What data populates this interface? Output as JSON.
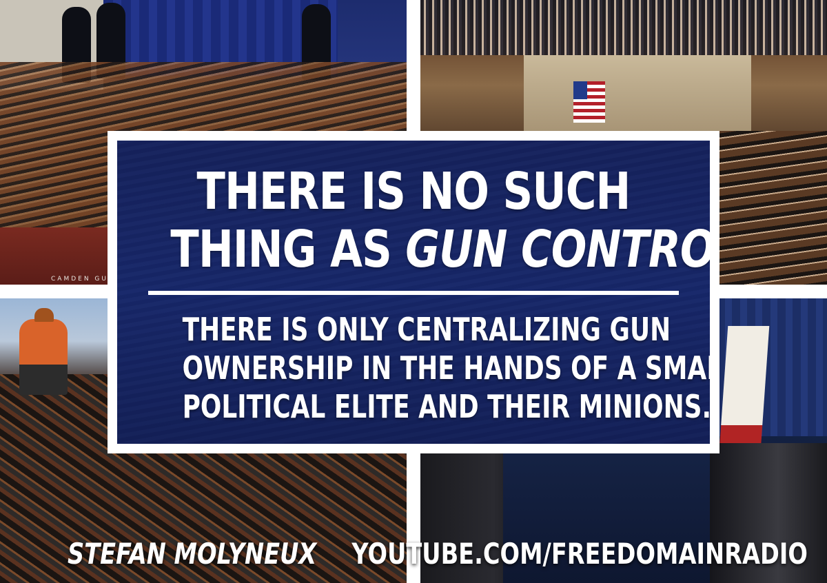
{
  "headline": {
    "line1": "THERE IS NO SUCH",
    "line2_prefix": "THING AS ",
    "line2_emphasis": "GUN CONTROL."
  },
  "subheadline": {
    "line1": "THERE IS ONLY CENTRALIZING GUN",
    "line2": "OWNERSHIP IN THE HANDS OF A SMALL",
    "line3": "POLITICAL ELITE AND THEIR MINIONS."
  },
  "author": "STEFAN MOLYNEUX",
  "url": "YOUTUBE.COM/FREEDOMAINRADIO",
  "photo_captions": {
    "amnesty_banner": "CAMDEN GUN AMNESTY PROGRAM"
  },
  "colors": {
    "panel_blue": "#16266a",
    "frame": "#ffffff",
    "text": "#ffffff"
  }
}
